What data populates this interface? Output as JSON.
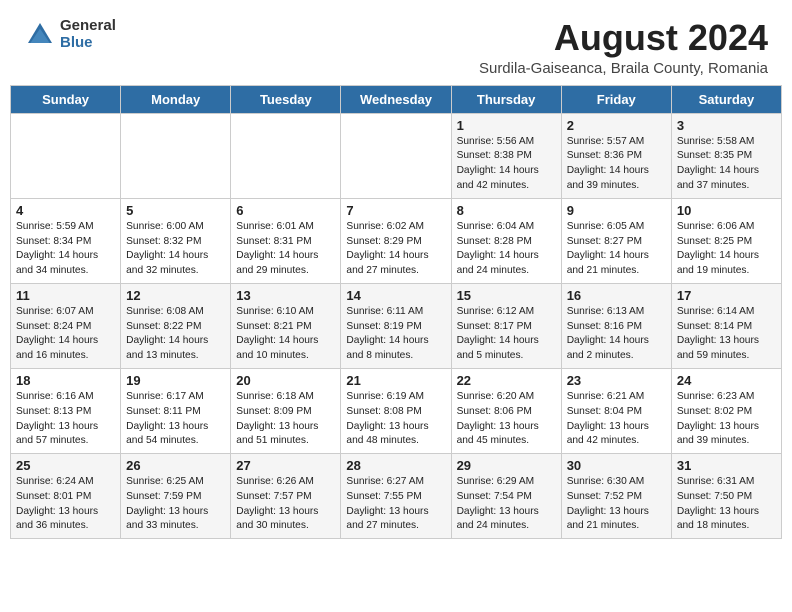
{
  "logo": {
    "general": "General",
    "blue": "Blue"
  },
  "title": "August 2024",
  "subtitle": "Surdila-Gaiseanca, Braila County, Romania",
  "days_of_week": [
    "Sunday",
    "Monday",
    "Tuesday",
    "Wednesday",
    "Thursday",
    "Friday",
    "Saturday"
  ],
  "weeks": [
    [
      {
        "day": "",
        "info": ""
      },
      {
        "day": "",
        "info": ""
      },
      {
        "day": "",
        "info": ""
      },
      {
        "day": "",
        "info": ""
      },
      {
        "day": "1",
        "info": "Sunrise: 5:56 AM\nSunset: 8:38 PM\nDaylight: 14 hours and 42 minutes."
      },
      {
        "day": "2",
        "info": "Sunrise: 5:57 AM\nSunset: 8:36 PM\nDaylight: 14 hours and 39 minutes."
      },
      {
        "day": "3",
        "info": "Sunrise: 5:58 AM\nSunset: 8:35 PM\nDaylight: 14 hours and 37 minutes."
      }
    ],
    [
      {
        "day": "4",
        "info": "Sunrise: 5:59 AM\nSunset: 8:34 PM\nDaylight: 14 hours and 34 minutes."
      },
      {
        "day": "5",
        "info": "Sunrise: 6:00 AM\nSunset: 8:32 PM\nDaylight: 14 hours and 32 minutes."
      },
      {
        "day": "6",
        "info": "Sunrise: 6:01 AM\nSunset: 8:31 PM\nDaylight: 14 hours and 29 minutes."
      },
      {
        "day": "7",
        "info": "Sunrise: 6:02 AM\nSunset: 8:29 PM\nDaylight: 14 hours and 27 minutes."
      },
      {
        "day": "8",
        "info": "Sunrise: 6:04 AM\nSunset: 8:28 PM\nDaylight: 14 hours and 24 minutes."
      },
      {
        "day": "9",
        "info": "Sunrise: 6:05 AM\nSunset: 8:27 PM\nDaylight: 14 hours and 21 minutes."
      },
      {
        "day": "10",
        "info": "Sunrise: 6:06 AM\nSunset: 8:25 PM\nDaylight: 14 hours and 19 minutes."
      }
    ],
    [
      {
        "day": "11",
        "info": "Sunrise: 6:07 AM\nSunset: 8:24 PM\nDaylight: 14 hours and 16 minutes."
      },
      {
        "day": "12",
        "info": "Sunrise: 6:08 AM\nSunset: 8:22 PM\nDaylight: 14 hours and 13 minutes."
      },
      {
        "day": "13",
        "info": "Sunrise: 6:10 AM\nSunset: 8:21 PM\nDaylight: 14 hours and 10 minutes."
      },
      {
        "day": "14",
        "info": "Sunrise: 6:11 AM\nSunset: 8:19 PM\nDaylight: 14 hours and 8 minutes."
      },
      {
        "day": "15",
        "info": "Sunrise: 6:12 AM\nSunset: 8:17 PM\nDaylight: 14 hours and 5 minutes."
      },
      {
        "day": "16",
        "info": "Sunrise: 6:13 AM\nSunset: 8:16 PM\nDaylight: 14 hours and 2 minutes."
      },
      {
        "day": "17",
        "info": "Sunrise: 6:14 AM\nSunset: 8:14 PM\nDaylight: 13 hours and 59 minutes."
      }
    ],
    [
      {
        "day": "18",
        "info": "Sunrise: 6:16 AM\nSunset: 8:13 PM\nDaylight: 13 hours and 57 minutes."
      },
      {
        "day": "19",
        "info": "Sunrise: 6:17 AM\nSunset: 8:11 PM\nDaylight: 13 hours and 54 minutes."
      },
      {
        "day": "20",
        "info": "Sunrise: 6:18 AM\nSunset: 8:09 PM\nDaylight: 13 hours and 51 minutes."
      },
      {
        "day": "21",
        "info": "Sunrise: 6:19 AM\nSunset: 8:08 PM\nDaylight: 13 hours and 48 minutes."
      },
      {
        "day": "22",
        "info": "Sunrise: 6:20 AM\nSunset: 8:06 PM\nDaylight: 13 hours and 45 minutes."
      },
      {
        "day": "23",
        "info": "Sunrise: 6:21 AM\nSunset: 8:04 PM\nDaylight: 13 hours and 42 minutes."
      },
      {
        "day": "24",
        "info": "Sunrise: 6:23 AM\nSunset: 8:02 PM\nDaylight: 13 hours and 39 minutes."
      }
    ],
    [
      {
        "day": "25",
        "info": "Sunrise: 6:24 AM\nSunset: 8:01 PM\nDaylight: 13 hours and 36 minutes."
      },
      {
        "day": "26",
        "info": "Sunrise: 6:25 AM\nSunset: 7:59 PM\nDaylight: 13 hours and 33 minutes."
      },
      {
        "day": "27",
        "info": "Sunrise: 6:26 AM\nSunset: 7:57 PM\nDaylight: 13 hours and 30 minutes."
      },
      {
        "day": "28",
        "info": "Sunrise: 6:27 AM\nSunset: 7:55 PM\nDaylight: 13 hours and 27 minutes."
      },
      {
        "day": "29",
        "info": "Sunrise: 6:29 AM\nSunset: 7:54 PM\nDaylight: 13 hours and 24 minutes."
      },
      {
        "day": "30",
        "info": "Sunrise: 6:30 AM\nSunset: 7:52 PM\nDaylight: 13 hours and 21 minutes."
      },
      {
        "day": "31",
        "info": "Sunrise: 6:31 AM\nSunset: 7:50 PM\nDaylight: 13 hours and 18 minutes."
      }
    ]
  ]
}
